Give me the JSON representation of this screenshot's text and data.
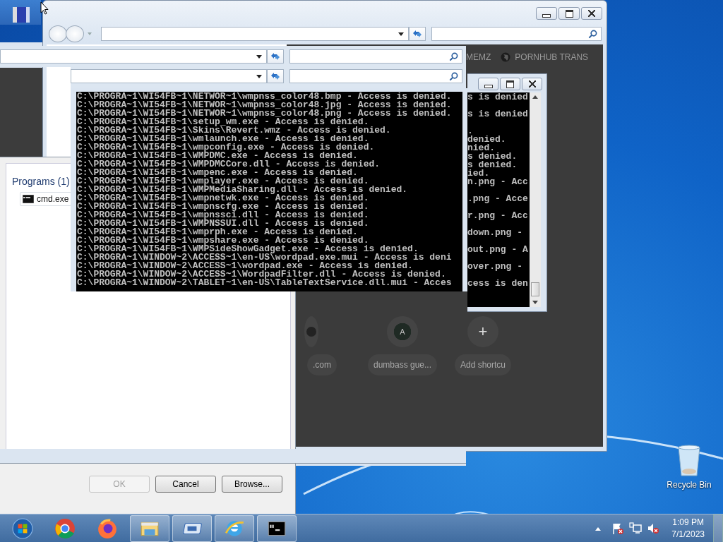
{
  "run_dialog": {
    "section_title": "Programs (1)",
    "results": [
      {
        "label": "cmd.exe"
      }
    ],
    "buttons": [
      {
        "label": "OK",
        "disabled": true
      },
      {
        "label": "Cancel",
        "disabled": false
      },
      {
        "label": "Browse...",
        "disabled": false
      }
    ]
  },
  "browser": {
    "tabs": [
      {
        "label": "MEMZ",
        "kind": "text"
      },
      {
        "label": "PORNHUB TRANS",
        "kind": "globe"
      }
    ],
    "shortcuts": [
      {
        "label": ".com",
        "kind": "site"
      },
      {
        "label": "dumbass gue...",
        "kind": "avatar",
        "initial": "A"
      },
      {
        "label": "Add shortcu",
        "kind": "add",
        "icon": "+"
      }
    ]
  },
  "console": {
    "lines": [
      "C:\\PROGRA~1\\WI54FB~1\\NETWOR~1\\wmpnss_color48.bmp - Access is denied.",
      "C:\\PROGRA~1\\WI54FB~1\\NETWOR~1\\wmpnss_color48.jpg - Access is denied.",
      "C:\\PROGRA~1\\WI54FB~1\\NETWOR~1\\wmpnss_color48.png - Access is denied.",
      "C:\\PROGRA~1\\WI54FB~1\\setup_wm.exe - Access is denied.",
      "C:\\PROGRA~1\\WI54FB~1\\Skins\\Revert.wmz - Access is denied.",
      "C:\\PROGRA~1\\WI54FB~1\\wmlaunch.exe - Access is denied.",
      "C:\\PROGRA~1\\WI54FB~1\\wmpconfig.exe - Access is denied.",
      "C:\\PROGRA~1\\WI54FB~1\\WMPDMC.exe - Access is denied.",
      "C:\\PROGRA~1\\WI54FB~1\\WMPDMCCore.dll - Access is denied.",
      "C:\\PROGRA~1\\WI54FB~1\\wmpenc.exe - Access is denied.",
      "C:\\PROGRA~1\\WI54FB~1\\wmplayer.exe - Access is denied.",
      "C:\\PROGRA~1\\WI54FB~1\\WMPMediaSharing.dll - Access is denied.",
      "C:\\PROGRA~1\\WI54FB~1\\wmpnetwk.exe - Access is denied.",
      "C:\\PROGRA~1\\WI54FB~1\\wmpnscfg.exe - Access is denied.",
      "C:\\PROGRA~1\\WI54FB~1\\wmpnssci.dll - Access is denied.",
      "C:\\PROGRA~1\\WI54FB~1\\WMPNSSUI.dll - Access is denied.",
      "C:\\PROGRA~1\\WI54FB~1\\wmprph.exe - Access is denied.",
      "C:\\PROGRA~1\\WI54FB~1\\wmpshare.exe - Access is denied.",
      "C:\\PROGRA~1\\WI54FB~1\\WMPSideShowGadget.exe - Access is denied.",
      "C:\\PROGRA~1\\WINDOW~2\\ACCESS~1\\en-US\\wordpad.exe.mui - Access is deni",
      "C:\\PROGRA~1\\WINDOW~2\\ACCESS~1\\wordpad.exe - Access is denied.",
      "C:\\PROGRA~1\\WINDOW~2\\ACCESS~1\\WordpadFilter.dll - Access is denied.",
      "C:\\PROGRA~1\\WINDOW~2\\TABLET~1\\en-US\\TableTextService.dll.mui - Acces"
    ]
  },
  "console_back": {
    "text": "s is denied\n\ns is denied\n\n.\ndenied.\nnied.\ns denied.\ns denied.\nied.\nn.png - Acc\n\n.png - Acce\n\nr.png - Acc\n\ndown.png -\n\nout.png - A\n\nover.png -\n\ncess is den"
  },
  "desktop_icons": [
    {
      "label": "Recycle Bin"
    }
  ],
  "taskbar": {
    "items": [
      {
        "kind": "start",
        "running": false
      },
      {
        "kind": "chrome",
        "running": false
      },
      {
        "kind": "firefox",
        "running": false
      },
      {
        "kind": "explorer",
        "running": true
      },
      {
        "kind": "window",
        "running": true
      },
      {
        "kind": "ie",
        "running": true
      },
      {
        "kind": "cmd",
        "running": true
      }
    ]
  },
  "tray": {
    "time": "1:09 PM",
    "date": "7/1/2023"
  }
}
